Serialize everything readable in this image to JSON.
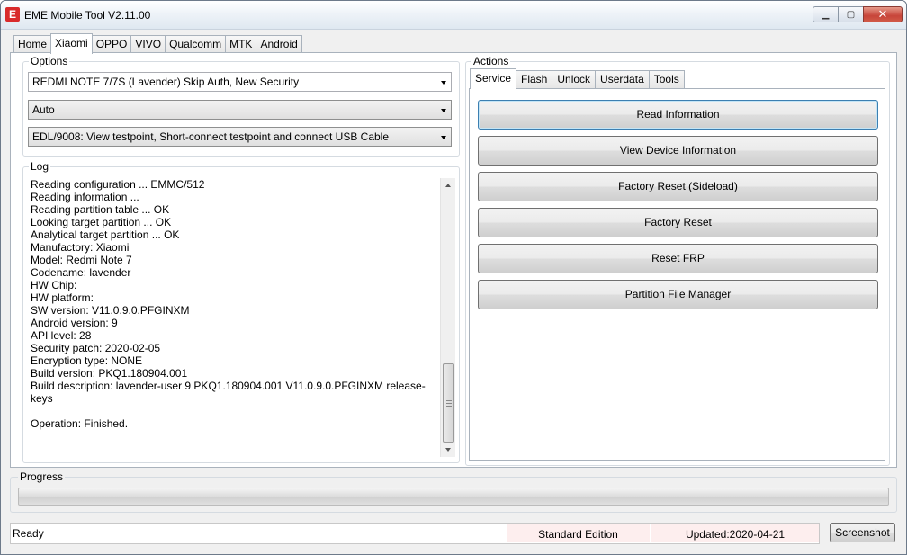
{
  "window": {
    "title": "EME Mobile Tool V2.11.00",
    "icon": "eme-app-icon",
    "controls": {
      "minimize": "minimize-icon",
      "maximize": "maximize-icon",
      "close": "close-icon"
    }
  },
  "main_tabs": [
    "Home",
    "Xiaomi",
    "OPPO",
    "VIVO",
    "Qualcomm",
    "MTK",
    "Android"
  ],
  "main_tabs_active": "Xiaomi",
  "options": {
    "label": "Options",
    "model_select": "REDMI NOTE 7/7S (Lavender) Skip Auth, New Security",
    "port_select": "Auto",
    "mode_select": "EDL/9008: View testpoint, Short-connect testpoint and connect USB Cable"
  },
  "log": {
    "label": "Log",
    "text": "Reading configuration ... EMMC/512\nReading information ...\nReading partition table ... OK\nLooking target partition ... OK\nAnalytical target partition ... OK\nManufactory: Xiaomi\nModel: Redmi Note 7\nCodename: lavender\nHW Chip:\nHW platform:\nSW version: V11.0.9.0.PFGINXM\nAndroid version: 9\nAPI level: 28\nSecurity patch: 2020-02-05\nEncryption type: NONE\nBuild version: PKQ1.180904.001\nBuild description: lavender-user 9 PKQ1.180904.001 V11.0.9.0.PFGINXM release-\nkeys\n\nOperation: Finished."
  },
  "actions": {
    "label": "Actions",
    "tabs": [
      "Service",
      "Flash",
      "Unlock",
      "Userdata",
      "Tools"
    ],
    "tabs_active": "Service",
    "buttons": [
      "Read Information",
      "View Device Information",
      "Factory Reset (Sideload)",
      "Factory Reset",
      "Reset FRP",
      "Partition File Manager"
    ]
  },
  "progress": {
    "label": "Progress",
    "value": 0
  },
  "status": {
    "text": "Ready",
    "edition": "Standard Edition",
    "updated": "Updated:2020-04-21",
    "screenshot_label": "Screenshot"
  },
  "colors": {
    "close_button": "#c8453a",
    "status_cell": "#fdeeee",
    "progress_fill": "#06b025"
  }
}
